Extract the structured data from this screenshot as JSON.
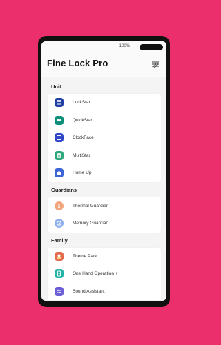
{
  "status": {
    "battery": "100%"
  },
  "header": {
    "title": "Fine Lock Pro",
    "settings_icon": "sliders-icon"
  },
  "sections": [
    {
      "title": "Unit",
      "items": [
        {
          "label": "LockStar",
          "icon": "lockstar-icon",
          "color": "#1f3fa3"
        },
        {
          "label": "QuickStar",
          "icon": "quickstar-icon",
          "color": "#0e8f79"
        },
        {
          "label": "ClockFace",
          "icon": "clockface-icon",
          "color": "#2f46c9"
        },
        {
          "label": "MultiStar",
          "icon": "multistar-icon",
          "color": "#2fa77d"
        },
        {
          "label": "Home Up",
          "icon": "homeup-icon",
          "color": "#3a64d8"
        }
      ]
    },
    {
      "title": "Guardians",
      "items": [
        {
          "label": "Thermal Guardian",
          "icon": "thermal-guardian-icon",
          "color": "#f2a47a"
        },
        {
          "label": "Memory Guardian",
          "icon": "memory-guardian-icon",
          "color": "#8fb0ee"
        }
      ]
    },
    {
      "title": "Family",
      "items": [
        {
          "label": "Theme Park",
          "icon": "theme-park-icon",
          "color": "#e26b4f"
        },
        {
          "label": "One Hand Operation +",
          "icon": "one-hand-operation-icon",
          "color": "#21b3a8"
        },
        {
          "label": "Sound Assistant",
          "icon": "sound-assistant-icon",
          "color": "#6b5fd8"
        }
      ]
    }
  ]
}
